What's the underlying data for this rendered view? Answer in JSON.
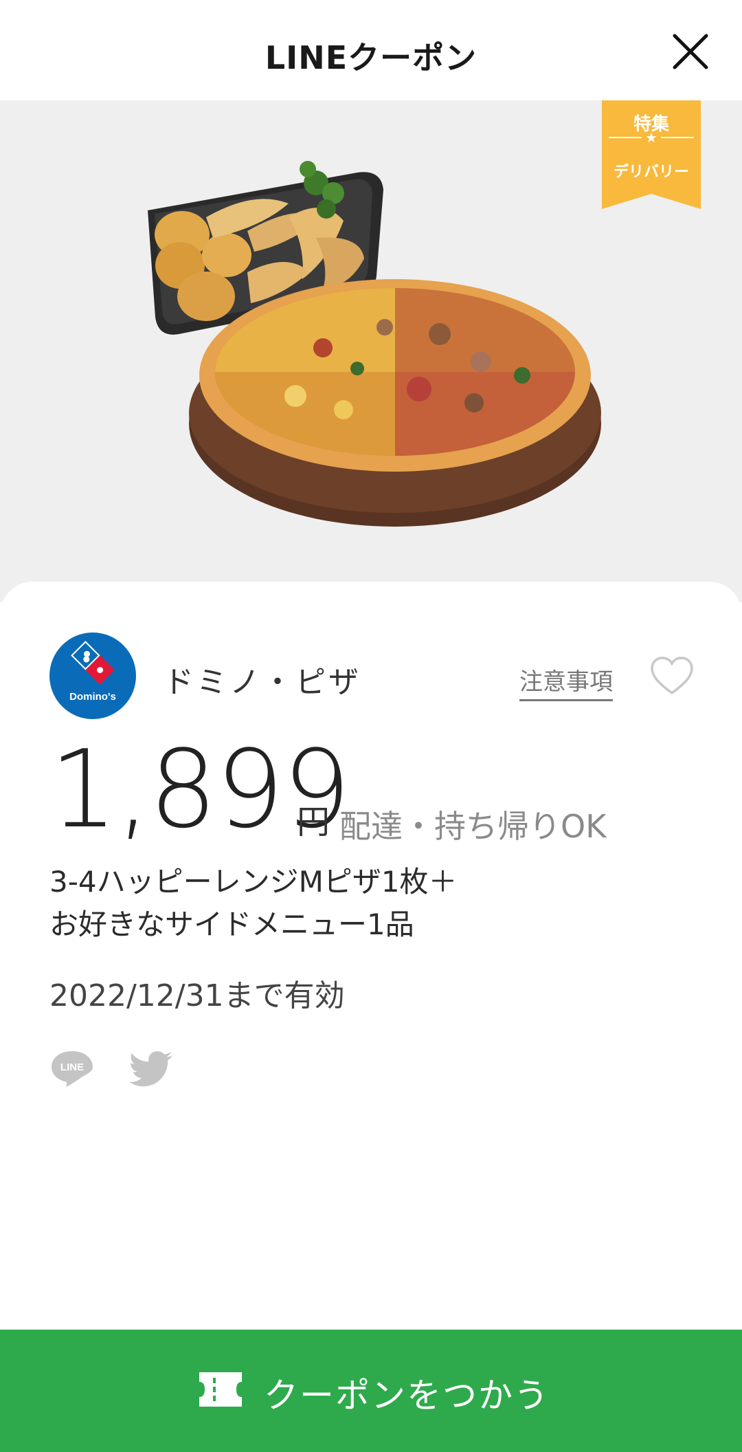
{
  "header": {
    "title": "LINEクーポン",
    "close_icon": "close-icon"
  },
  "badge": {
    "line1": "特集",
    "star": "★",
    "line2": "デリバリー",
    "color": "#f8b93c"
  },
  "store": {
    "name": "ドミノ・ピザ",
    "logo_text": "Domino's",
    "notes_label": "注意事項"
  },
  "offer": {
    "price": "1,899",
    "currency": "円",
    "delivery_note": "配達・持ち帰りOK",
    "description_line1": "3-4ハッピーレンジMピザ1枚＋",
    "description_line2": "お好きなサイドメニュー1品",
    "valid_until": "2022/12/31まで有効"
  },
  "share": {
    "line_icon_text": "LINE"
  },
  "cta": {
    "label": "クーポンをつかう",
    "color": "#2eaa4c"
  }
}
